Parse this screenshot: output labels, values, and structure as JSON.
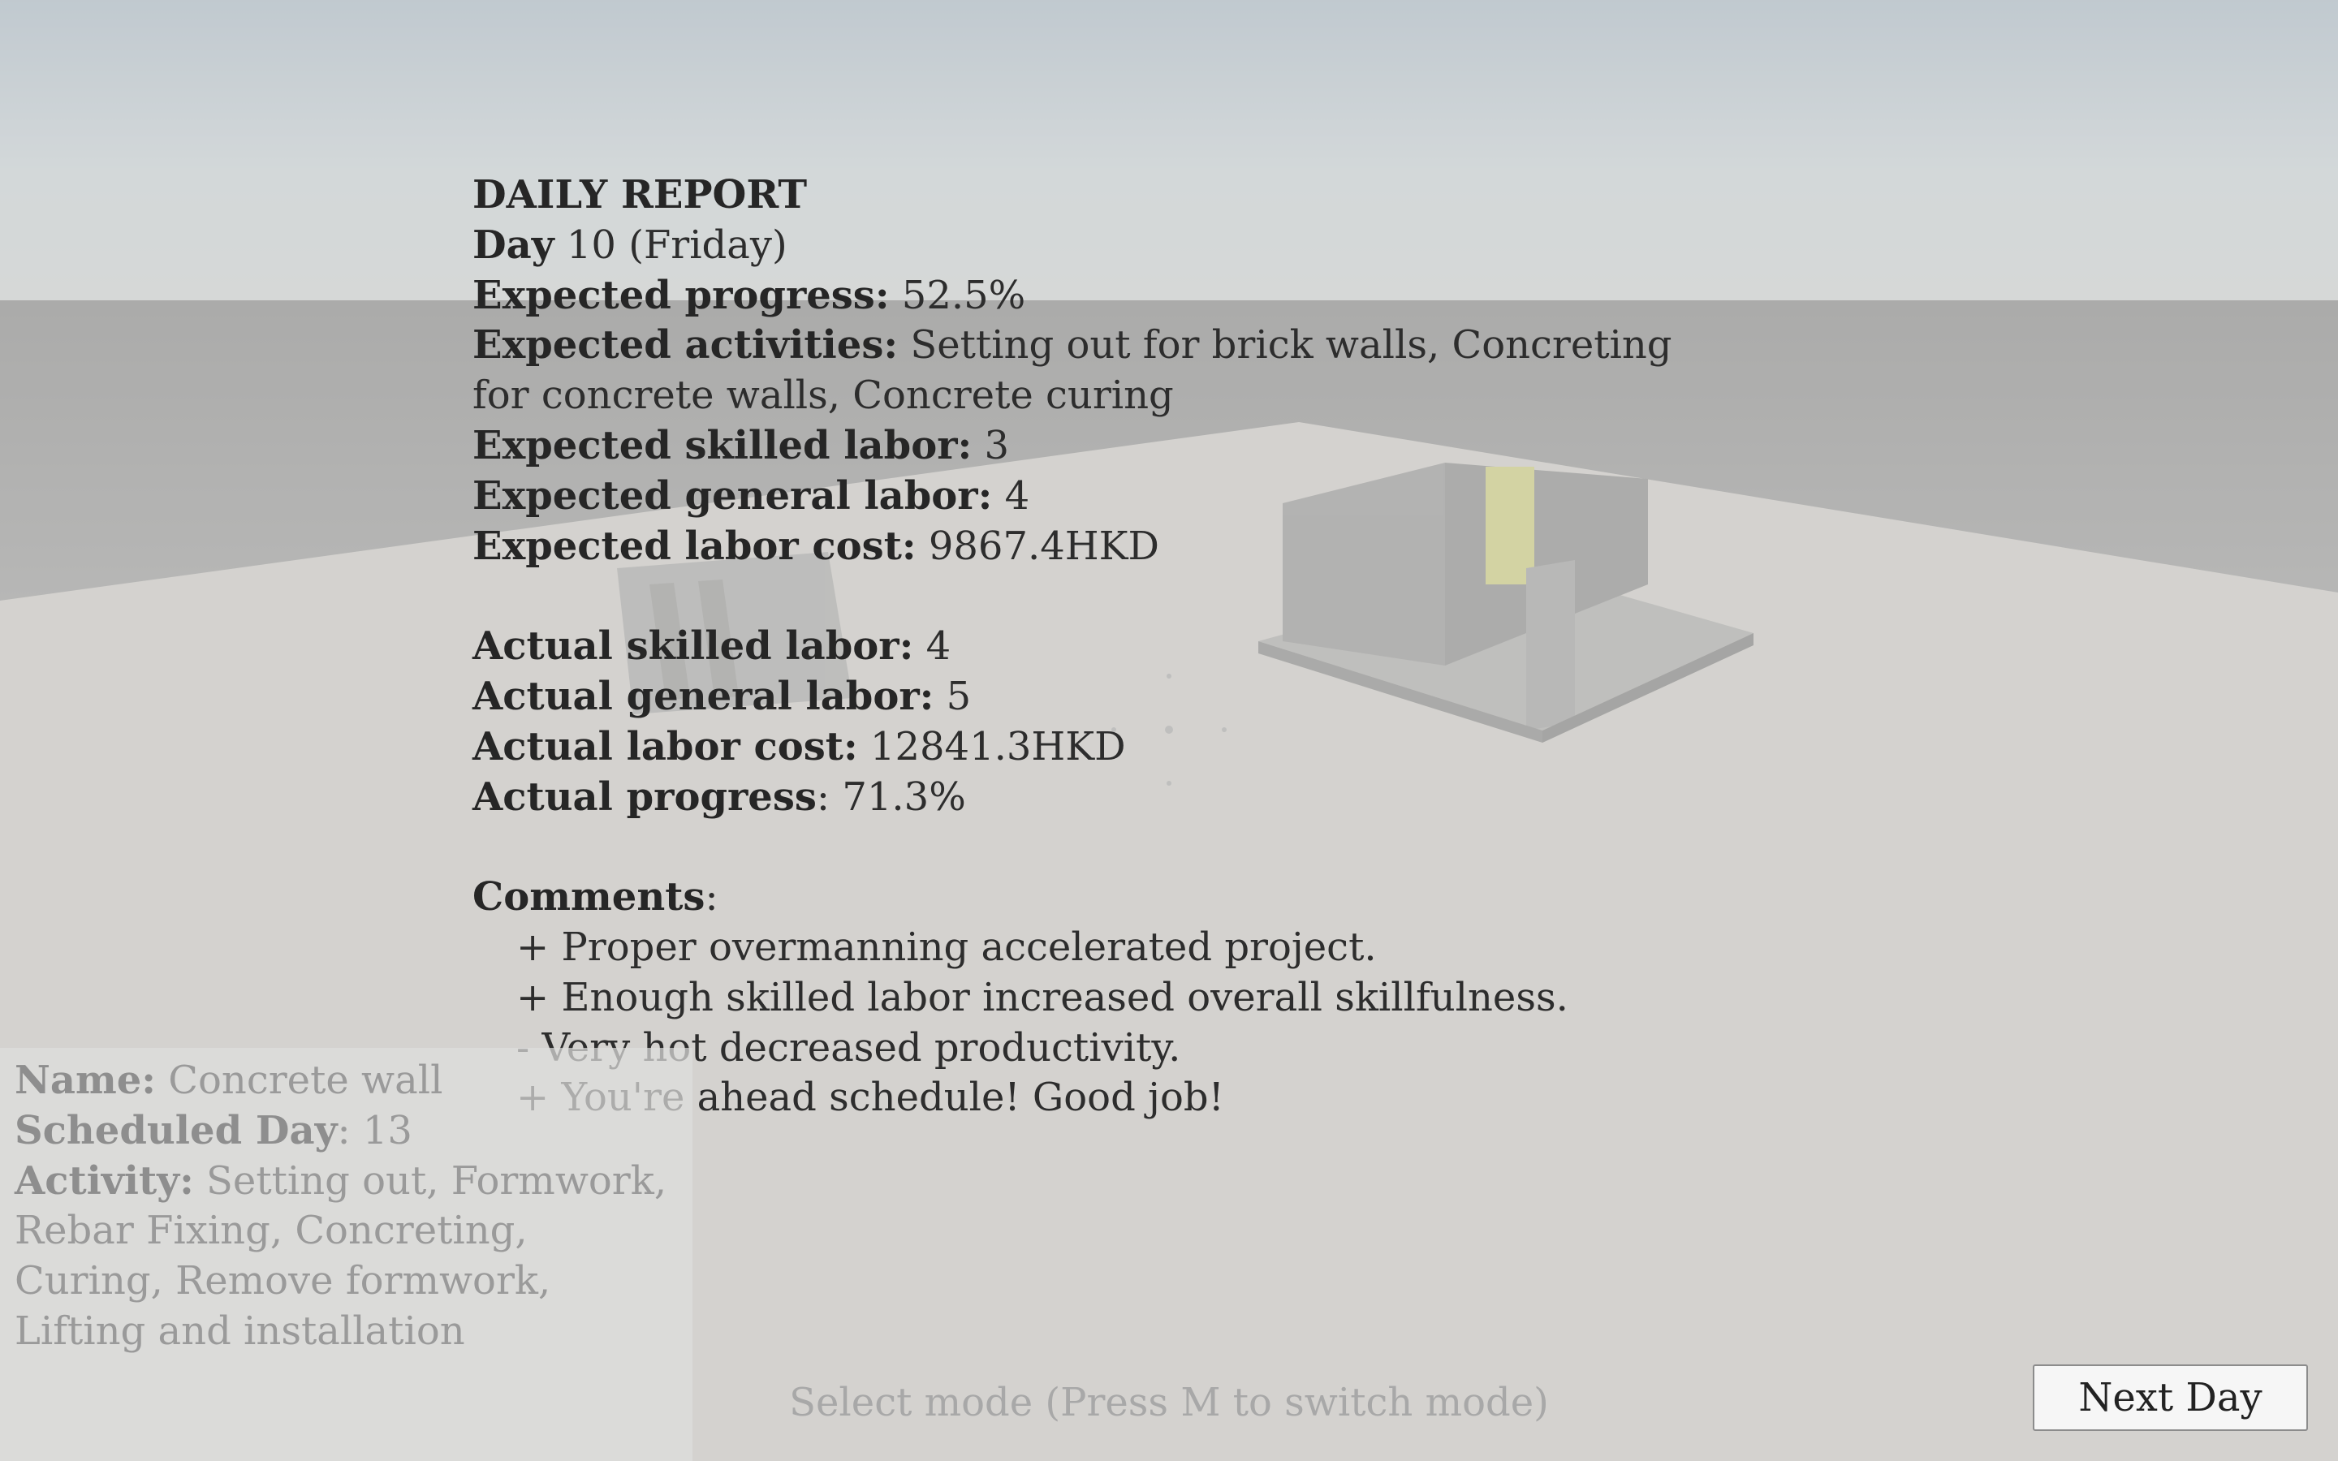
{
  "report": {
    "title": "DAILY REPORT",
    "day_label": "Day",
    "day_value": " 10 (Friday)",
    "expected_progress_label": "Expected progress:",
    "expected_progress_value": " 52.5%",
    "expected_activities_label": "Expected activities:",
    "expected_activities_value": " Setting out for brick walls, Concreting for concrete walls, Concrete curing",
    "expected_skilled_label": "Expected skilled labor:",
    "expected_skilled_value": " 3",
    "expected_general_label": "Expected general labor:",
    "expected_general_value": " 4",
    "expected_cost_label": "Expected labor cost:",
    "expected_cost_value": " 9867.4HKD",
    "actual_skilled_label": "Actual skilled labor:",
    "actual_skilled_value": " 4",
    "actual_general_label": "Actual general labor:",
    "actual_general_value": " 5",
    "actual_cost_label": "Actual labor cost:",
    "actual_cost_value": " 12841.3HKD",
    "actual_progress_label": "Actual progress",
    "actual_progress_value": ": 71.3%",
    "comments_label": "Comments",
    "comments_colon": ":",
    "comments": [
      "+ Proper overmanning accelerated project.",
      "+ Enough skilled labor increased overall skillfulness.",
      "- Very hot decreased productivity.",
      "+ You're ahead schedule! Good job!"
    ]
  },
  "info": {
    "name_label": "Name:",
    "name_value": " Concrete wall",
    "scheduled_label": "Scheduled Day",
    "scheduled_value": ": 13",
    "activity_label": "Activity:",
    "activity_value": " Setting out, Formwork, Rebar Fixing, Concreting, Curing, Remove formwork, Lifting and installation"
  },
  "mode_hint": "Select mode (Press M to switch mode)",
  "next_day_label": "Next Day"
}
